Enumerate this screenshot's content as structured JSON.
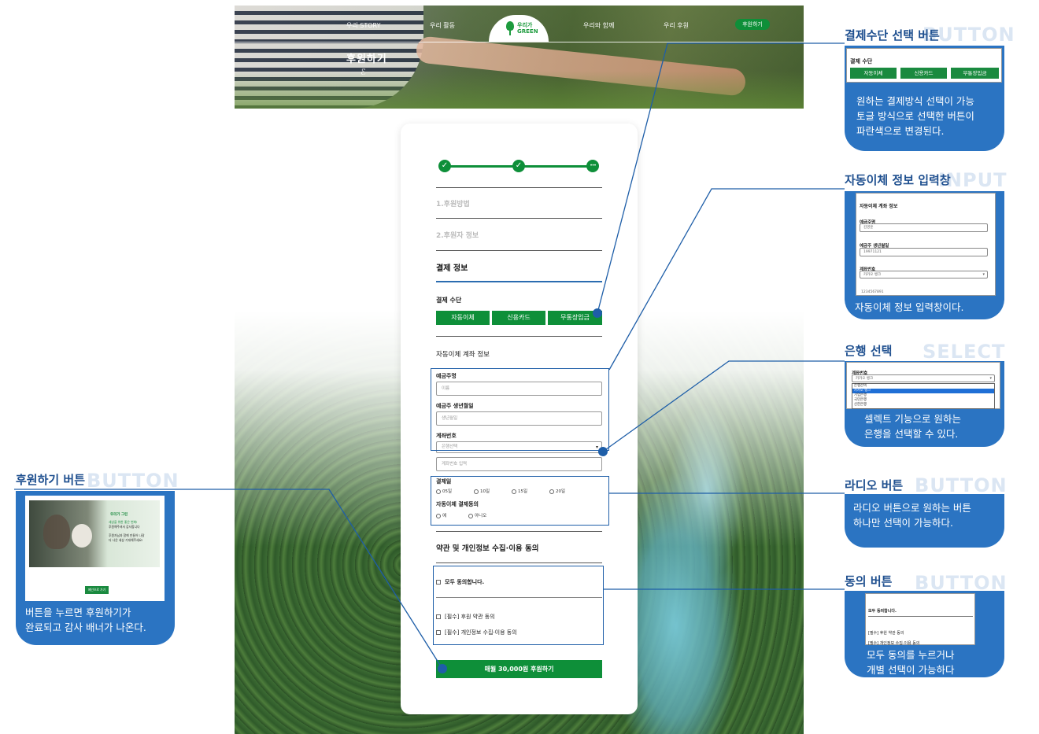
{
  "nav": {
    "items": [
      "우리 STORY",
      "우리 활동",
      "우리와 함께",
      "우리 후원"
    ],
    "logo_line1": "우리가",
    "logo_line2": "GREEN",
    "cta": "후원하기"
  },
  "hero": {
    "title": "후원하기",
    "deco": "ℰ"
  },
  "form": {
    "step_icons": [
      "✓",
      "✓",
      "•••"
    ],
    "section1": "1.후원방법",
    "section2": "2.후원자 정보",
    "section3": "결제 정보",
    "pay_method_label": "결제 수단",
    "pay_methods": [
      "자동이체",
      "신용카드",
      "무통장입금"
    ],
    "auto_title": "자동이체 계좌 정보",
    "holder_label": "예금주명",
    "holder_placeholder": "이름",
    "birth_label": "예금주 생년월일",
    "birth_placeholder": "생년월일",
    "account_label": "계좌번호",
    "bank_select": "은행선택",
    "account_placeholder": "계좌번호 입력",
    "payday_label": "결제일",
    "paydays": [
      "05일",
      "10일",
      "15일",
      "20일"
    ],
    "consent_label": "자동이체 결제동의",
    "consent_options": [
      "예",
      "아니오"
    ],
    "terms_title": "약관 및 개인정보 수집·이용 동의",
    "agree_all": "모두 동의합니다.",
    "agree_terms": "[필수] 후원 약관 동의",
    "agree_privacy": "[필수] 개인정보 수집·이용 동의",
    "submit": "매월 30,000원 후원하기"
  },
  "annotations": {
    "pay": {
      "title": "결제수단 선택 버튼",
      "ghost": "BUTTON",
      "panel_label": "결제 수단",
      "panel_buttons": [
        "자동이체",
        "신용카드",
        "무통장입금"
      ],
      "text": [
        "원하는 결제방식 선택이 가능",
        "토글 방식으로 선택한 버튼이",
        "파란색으로 변경된다."
      ]
    },
    "auto": {
      "title": "자동이체 정보 입력창",
      "ghost": "INPUT",
      "panel_title": "자동이체 계좌 정보",
      "holder_label": "예금주명",
      "holder_value": "김영훈",
      "birth_label": "예금주 생년월일",
      "birth_value": "19971121",
      "account_label": "계좌번호",
      "bank_value": "카카오 뱅크",
      "account_value": "1234567891",
      "text": [
        "자동이체 정보 입력창이다."
      ]
    },
    "bank": {
      "title": "은행 선택",
      "ghost": "SELECT",
      "panel_label": "계좌번호",
      "select_value": "카카오 뱅크",
      "options": [
        "은행선택",
        "카카오 뱅크",
        "기업은행",
        "국민은행",
        "신한은행"
      ],
      "text": [
        "셀렉트 기능으로 원하는",
        "은행을 선택할 수 있다."
      ]
    },
    "radio": {
      "title": "라디오 버튼",
      "ghost": "BUTTON",
      "text": [
        "라디오 버튼으로 원하는 버튼",
        "하나만 선택이 가능하다."
      ]
    },
    "agree": {
      "title": "동의 버튼",
      "ghost": "BUTTON",
      "panel_all": "모두 동의합니다.",
      "panel_terms": "[필수] 후원 약관 동의",
      "panel_privacy": "[필수] 개인정보 수집·이용 동의",
      "text": [
        "모두 동의를 누르거나",
        "개별 선택이 가능하다"
      ]
    },
    "donate": {
      "title": "후원하기 버튼",
      "ghost": "BUTTON",
      "banner_title": "우리가 그린",
      "banner_lines": [
        "세상을 위한 좋은 변화!",
        "후원해주셔서 감사합니다",
        "후원자님과 함께 만들어 나갈",
        "더 나은 세상 기대해주세요!"
      ],
      "banner_button": "메인으로 가기",
      "text": [
        "버튼을 누르면 후원하기가",
        "완료되고 감사 배너가 나온다."
      ]
    }
  },
  "colors": {
    "green": "#0e8f39",
    "blue": "#2b74c2",
    "annotation_title": "#1e4f8f"
  }
}
